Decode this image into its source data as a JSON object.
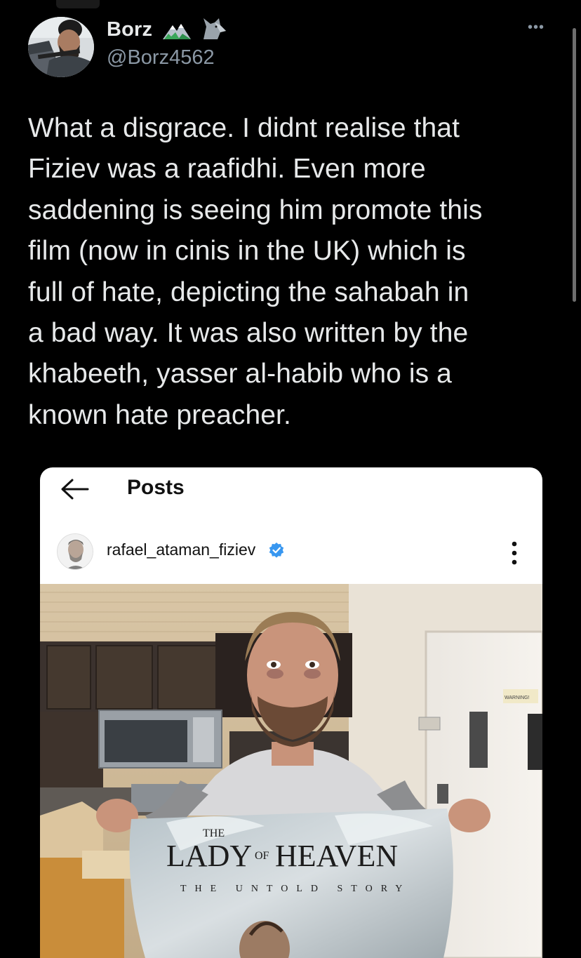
{
  "tweet": {
    "display_name": "Borz",
    "handle": "@Borz4562",
    "more_label": "•••",
    "text": "What a disgrace. I didnt realise that\nFiziev was a raafidhi. Even more\nsaddening is seeing him promote this\nfilm (now in cinis in the UK) which is\nfull of hate, depicting the sahabah in\na bad way. It was also written by the\nkhabeeth, yasser al-habib who is a\nknown hate preacher."
  },
  "embedded_post": {
    "header_title": "Posts",
    "username": "rafael_ataman_fiziev",
    "poster": {
      "small_word": "THE",
      "title_left": "LADY",
      "title_mid": "OF",
      "title_right": "HEAVEN",
      "tagline": "THE UNTOLD STORY"
    },
    "warning_sign": "WARNING!"
  },
  "colors": {
    "background": "#000000",
    "primary_text": "#e7e9ea",
    "secondary_text": "#8b98a5",
    "verified_blue": "#3897f0"
  },
  "icons": [
    "mountain-badge-icon",
    "wolf-badge-icon",
    "more-options-icon",
    "back-arrow-icon",
    "verified-badge-icon",
    "kebab-menu-icon"
  ]
}
